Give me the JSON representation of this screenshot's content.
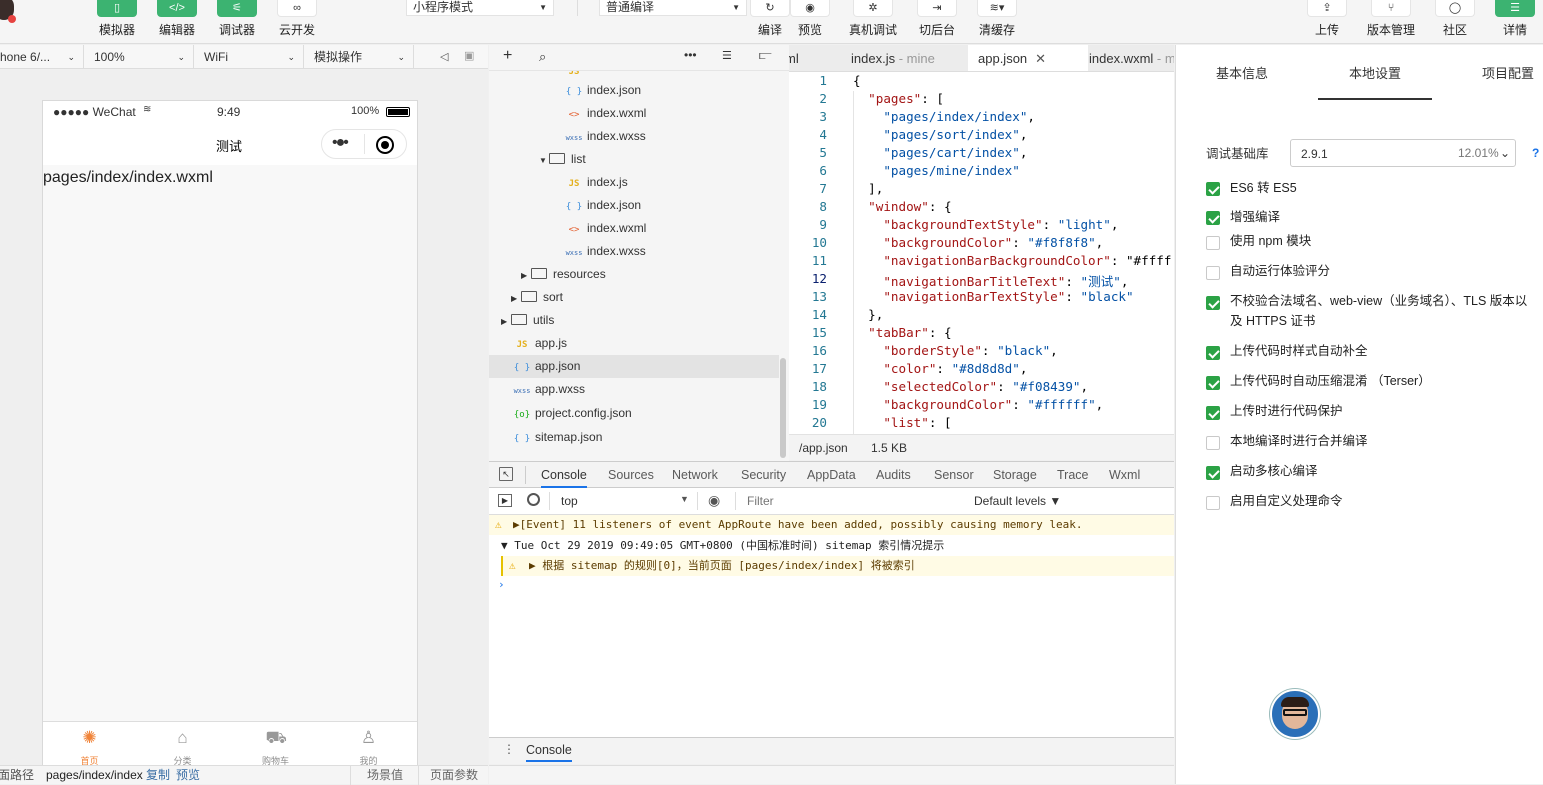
{
  "toolbar": {
    "buttons": [
      {
        "label": "模拟器",
        "icon": "phone-icon"
      },
      {
        "label": "编辑器",
        "icon": "code-icon"
      },
      {
        "label": "调试器",
        "icon": "debug-icon"
      },
      {
        "label": "云开发",
        "icon": "cloud-link-icon"
      }
    ],
    "mode_select": "小程序模式",
    "compile_select": "普通编译",
    "actions": [
      {
        "label": "编译",
        "icon": "refresh-icon"
      },
      {
        "label": "预览",
        "icon": "eye-icon"
      },
      {
        "label": "真机调试",
        "icon": "bug-icon"
      },
      {
        "label": "切后台",
        "icon": "switch-icon"
      },
      {
        "label": "清缓存",
        "icon": "layers-icon"
      }
    ],
    "right": [
      {
        "label": "上传",
        "icon": "upload-icon"
      },
      {
        "label": "版本管理",
        "icon": "branch-icon"
      },
      {
        "label": "社区",
        "icon": "chat-icon"
      },
      {
        "label": "详情",
        "icon": "menu-icon"
      }
    ]
  },
  "simulator": {
    "device": "hone 6/...",
    "zoom": "100%",
    "network": "WiFi",
    "operation": "模拟操作",
    "status": {
      "carrier": "●●●●● WeChat",
      "time": "9:49",
      "battery": "100%"
    },
    "nav_title": "测试",
    "page_text": "pages/index/index.wxml",
    "tabs": [
      {
        "label": "首页",
        "icon": "home-icon"
      },
      {
        "label": "分类",
        "icon": "bag-icon"
      },
      {
        "label": "购物车",
        "icon": "cart-icon"
      },
      {
        "label": "我的",
        "icon": "user-icon"
      }
    ],
    "footer": {
      "path_label": "面路径",
      "path": "pages/index/index",
      "copy": "复制",
      "preview": "预览",
      "scene": "场景值",
      "params": "页面参数"
    }
  },
  "tree": {
    "items": [
      {
        "name": "index.json",
        "type": "json"
      },
      {
        "name": "index.wxml",
        "type": "wxml"
      },
      {
        "name": "index.wxss",
        "type": "wxss"
      },
      {
        "name": "list",
        "type": "folder-open"
      },
      {
        "name": "index.js",
        "type": "js"
      },
      {
        "name": "index.json",
        "type": "json"
      },
      {
        "name": "index.wxml",
        "type": "wxml"
      },
      {
        "name": "index.wxss",
        "type": "wxss"
      },
      {
        "name": "resources",
        "type": "folder"
      },
      {
        "name": "sort",
        "type": "folder"
      },
      {
        "name": "utils",
        "type": "folder"
      },
      {
        "name": "app.js",
        "type": "js"
      },
      {
        "name": "app.json",
        "type": "json"
      },
      {
        "name": "app.wxss",
        "type": "wxss"
      },
      {
        "name": "project.config.json",
        "type": "cfg"
      },
      {
        "name": "sitemap.json",
        "type": "json"
      }
    ]
  },
  "editor": {
    "tabs": [
      {
        "label": "ml",
        "suffix": ""
      },
      {
        "label": "index.js",
        "suffix": " - mine"
      },
      {
        "label": "app.json",
        "suffix": ""
      },
      {
        "label": "index.wxml",
        "suffix": " - m"
      }
    ],
    "lines": [
      "{",
      "  \"pages\": [",
      "    \"pages/index/index\",",
      "    \"pages/sort/index\",",
      "    \"pages/cart/index\",",
      "    \"pages/mine/index\"",
      "  ],",
      "  \"window\": {",
      "    \"backgroundTextStyle\": \"light\",",
      "    \"backgroundColor\": \"#f8f8f8\",",
      "    \"navigationBarBackgroundColor\": \"#ffff",
      "    \"navigationBarTitleText\": \"测试\",",
      "    \"navigationBarTextStyle\": \"black\"",
      "  },",
      "  \"tabBar\": {",
      "    \"borderStyle\": \"black\",",
      "    \"color\": \"#8d8d8d\",",
      "    \"selectedColor\": \"#f08439\",",
      "    \"backgroundColor\": \"#ffffff\",",
      "    \"list\": ["
    ],
    "line_numbers": [
      "1",
      "2",
      "3",
      "4",
      "5",
      "6",
      "7",
      "8",
      "9",
      "10",
      "11",
      "12",
      "13",
      "14",
      "15",
      "16",
      "17",
      "18",
      "19",
      "20"
    ],
    "status_path": "/app.json",
    "status_size": "1.5 KB"
  },
  "devtools": {
    "tabs": [
      "Console",
      "Sources",
      "Network",
      "Security",
      "AppData",
      "Audits",
      "Sensor",
      "Storage",
      "Trace",
      "Wxml"
    ],
    "context": "top",
    "filter_placeholder": "Filter",
    "levels": "Default levels ▼",
    "messages": [
      "▶[Event] 11 listeners of event AppRoute have been added, possibly causing memory leak.",
      "▼ Tue Oct 29 2019 09:49:05 GMT+0800 (中国标准时间) sitemap 索引情况提示",
      "▶ 根据 sitemap 的规则[0]，当前页面 [pages/index/index] 将被索引"
    ],
    "drawer_tab": "Console"
  },
  "settings": {
    "tabs": [
      "基本信息",
      "本地设置",
      "项目配置"
    ],
    "lib_label": "调试基础库",
    "lib_version": "2.9.1",
    "lib_percent": "12.01%",
    "help": "?",
    "options": [
      {
        "label": "ES6 转 ES5",
        "checked": true
      },
      {
        "label": "增强编译",
        "checked": true
      },
      {
        "label": "使用 npm 模块",
        "checked": false
      },
      {
        "label": "自动运行体验评分",
        "checked": false
      },
      {
        "label": "不校验合法域名、web-view（业务域名）、TLS 版本以及 HTTPS 证书",
        "checked": true
      },
      {
        "label": "上传代码时样式自动补全",
        "checked": true
      },
      {
        "label": "上传代码时自动压缩混淆 （Terser）",
        "checked": true
      },
      {
        "label": "上传时进行代码保护",
        "checked": true
      },
      {
        "label": "本地编译时进行合并编译",
        "checked": false
      },
      {
        "label": "启动多核心编译",
        "checked": true
      },
      {
        "label": "启用自定义处理命令",
        "checked": false
      }
    ]
  },
  "colors": {
    "accent": "#2ba245",
    "tab_active": "#f08439"
  }
}
